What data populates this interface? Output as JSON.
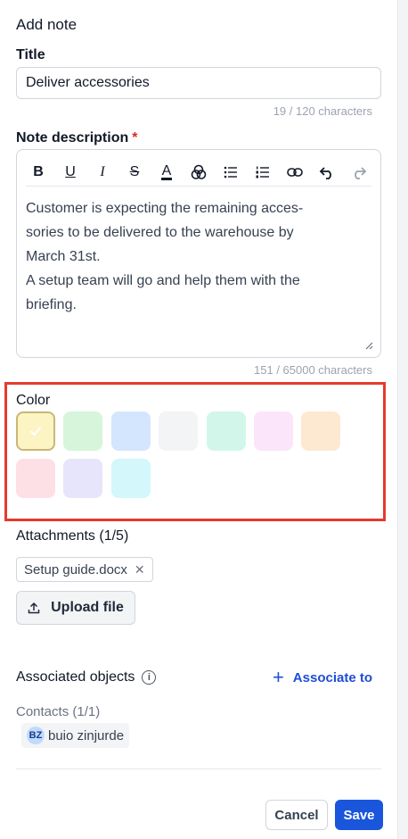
{
  "header": {
    "title": "Add note"
  },
  "title_field": {
    "label": "Title",
    "value": "Deliver accessories",
    "counter": "19 / 120 characters"
  },
  "description": {
    "label": "Note description",
    "required_marker": "*",
    "toolbar": {
      "bold": "B",
      "underline": "U",
      "italic": "I",
      "strikethrough": "S",
      "text_color": "A"
    },
    "text_lines": [
      "Customer is expecting the remaining acces-",
      "sories to be delivered to the warehouse by",
      "March 31st.",
      "A setup team will go and help them with the",
      "briefing."
    ],
    "counter": "151 / 65000 characters"
  },
  "color": {
    "label": "Color",
    "selected_index": 0,
    "swatches": [
      "#fdf4c3",
      "#d6f5db",
      "#d4e6fd",
      "#f3f4f6",
      "#d2f7ea",
      "#fbe5fb",
      "#fde9d2",
      "#fde0e6",
      "#e7e5fb",
      "#d3f7fa"
    ]
  },
  "attachments": {
    "label": "Attachments (1/5)",
    "file_name": "Setup guide.docx",
    "remove_glyph": "✕",
    "upload_label": "Upload file"
  },
  "associated": {
    "label": "Associated objects",
    "info_glyph": "i",
    "associate_label": "Associate to",
    "plus_glyph": "+",
    "contacts_label": "Contacts (1/1)",
    "contact_initials": "BZ",
    "contact_name": "buio zinjurde"
  },
  "footer": {
    "cancel_label": "Cancel",
    "save_label": "Save"
  },
  "accent_color": "#1a56db",
  "highlight_color": "#e53b2c"
}
